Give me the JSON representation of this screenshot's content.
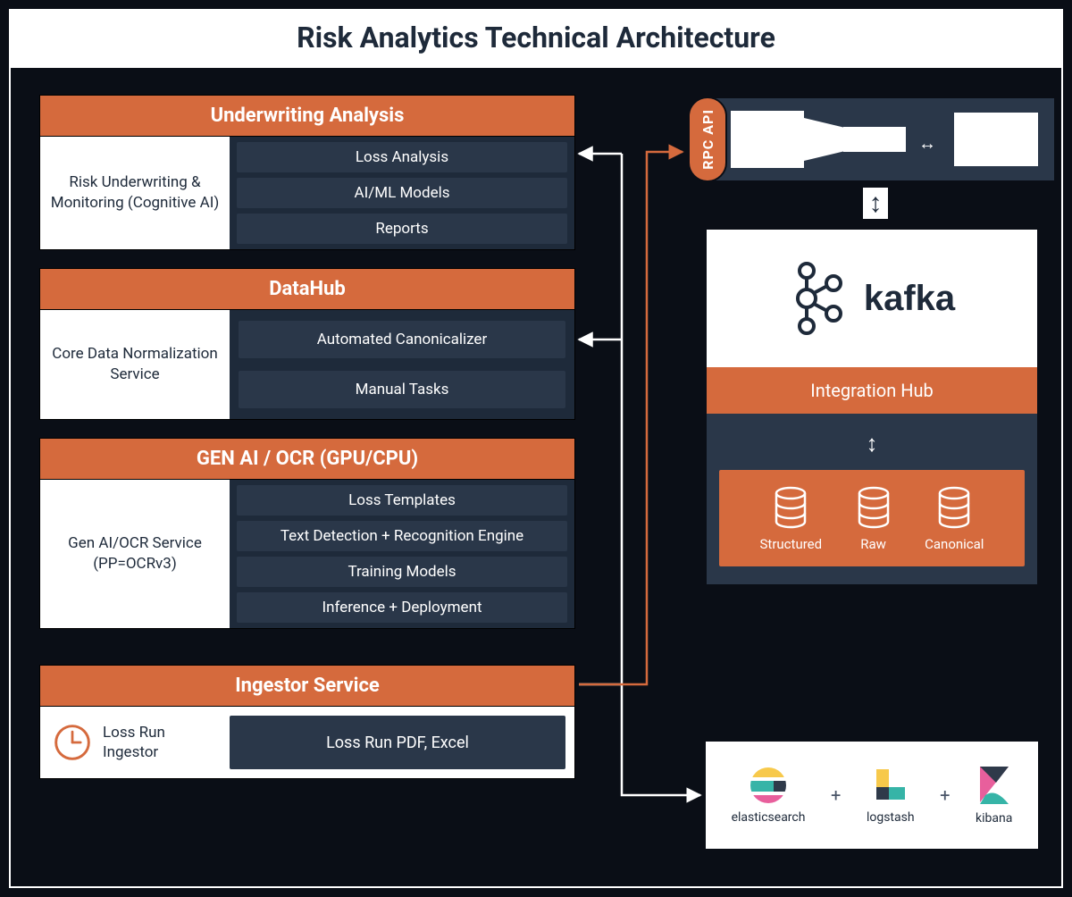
{
  "title": "Risk Analytics Technical Architecture",
  "modules": {
    "underwriting": {
      "header": "Underwriting Analysis",
      "left": "Risk Underwriting & Monitoring (Cognitive AI)",
      "rows": [
        "Loss Analysis",
        "AI/ML Models",
        "Reports"
      ]
    },
    "datahub": {
      "header": "DataHub",
      "left": "Core Data Normalization Service",
      "rows": [
        "Automated Canonicalizer",
        "Manual Tasks"
      ]
    },
    "genai": {
      "header": "GEN AI / OCR (GPU/CPU)",
      "left": "Gen AI/OCR Service (PP=OCRv3)",
      "rows": [
        "Loss Templates",
        "Text Detection + Recognition Engine",
        "Training Models",
        "Inference + Deployment"
      ]
    },
    "ingestor": {
      "header": "Ingestor Service",
      "left": "Loss Run Ingestor",
      "right": "Loss Run PDF, Excel"
    }
  },
  "rpc_label": "RPC API",
  "kafka_label": "kafka",
  "integration_hub_label": "Integration Hub",
  "db_labels": [
    "Structured",
    "Raw",
    "Canonical"
  ],
  "elk": {
    "items": [
      "elasticsearch",
      "logstash",
      "kibana"
    ],
    "separator": "+"
  }
}
